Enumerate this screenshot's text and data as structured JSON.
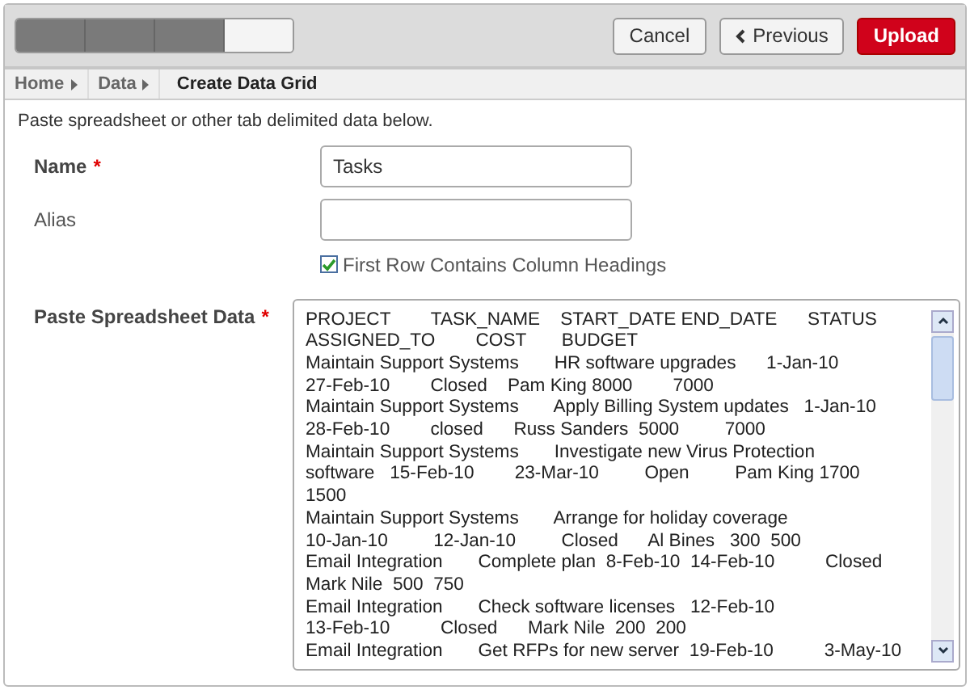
{
  "toolbar": {
    "progress_steps": [
      {
        "done": true
      },
      {
        "done": true
      },
      {
        "done": true
      },
      {
        "done": false
      }
    ],
    "buttons": [
      {
        "label": "Cancel",
        "kind": "plain"
      },
      {
        "label": "Previous",
        "kind": "back"
      },
      {
        "label": "Upload",
        "kind": "primary"
      }
    ]
  },
  "breadcrumb": [
    {
      "label": "Home",
      "current": false
    },
    {
      "label": "Data",
      "current": false
    },
    {
      "label": "Create Data Grid",
      "current": true
    }
  ],
  "instructions": "Paste spreadsheet or other tab delimited data below.",
  "form": {
    "name": {
      "label": "Name",
      "required_mark": "*",
      "value": "Tasks"
    },
    "alias": {
      "label": "Alias"
    },
    "first_row_headings": {
      "label": "First Row Contains Column Headings",
      "checked": true
    },
    "paste_data": {
      "label": "Paste Spreadsheet Data",
      "required_mark": "*",
      "lines": [
        "PROJECT        TASK_NAME    START_DATE END_DATE      STATUS",
        "ASSIGNED_TO        COST       BUDGET",
        "Maintain Support Systems       HR software upgrades      1-Jan-10",
        "27-Feb-10        Closed    Pam King 8000        7000",
        "Maintain Support Systems       Apply Billing System updates   1-Jan-10",
        "28-Feb-10        closed      Russ Sanders  5000         7000",
        "Maintain Support Systems       Investigate new Virus Protection",
        "software   15-Feb-10        23-Mar-10         Open         Pam King 1700",
        "1500",
        "Maintain Support Systems       Arrange for holiday coverage",
        "10-Jan-10         12-Jan-10         Closed      Al Bines   300  500",
        "Email Integration       Complete plan  8-Feb-10  14-Feb-10          Closed",
        "Mark Nile  500  750",
        "Email Integration       Check software licenses   12-Feb-10",
        "13-Feb-10          Closed      Mark Nile  200  200",
        "Email Integration       Get RFPs for new server  19-Feb-10          3-May-10"
      ]
    }
  }
}
